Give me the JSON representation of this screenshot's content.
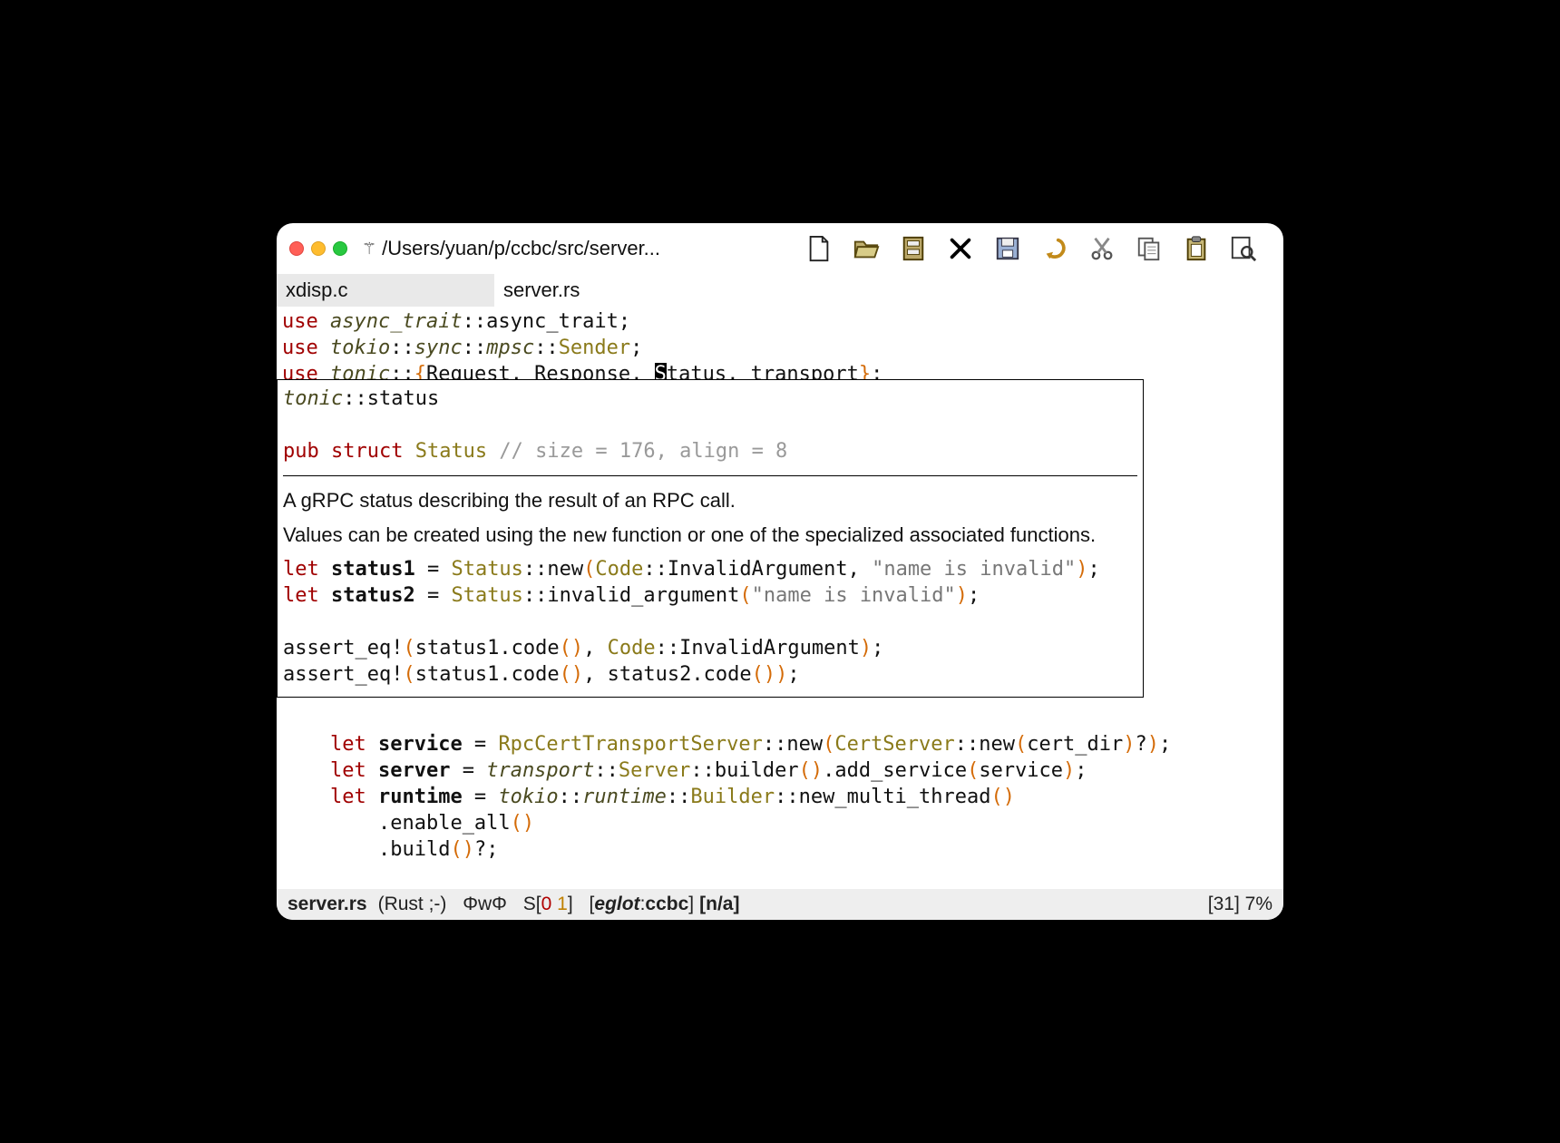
{
  "window": {
    "vc_glyph": "⚚",
    "title": "/Users/yuan/p/ccbc/src/server..."
  },
  "toolbar": {
    "new": "New",
    "open": "Open",
    "dir": "Dired",
    "kill": "Kill buffer",
    "save": "Save",
    "undo": "Undo",
    "cut": "Cut",
    "copy": "Copy",
    "paste": "Paste",
    "search": "Search"
  },
  "tabs": [
    {
      "label": "xdisp.c",
      "active": false
    },
    {
      "label": "server.rs",
      "active": true
    }
  ],
  "code_top": {
    "l1": {
      "kw": "use ",
      "mod": "async_trait",
      "rest": "::async_trait;"
    },
    "l2": {
      "kw": "use ",
      "mod1": "tokio",
      "sep1": "::",
      "mod2": "sync",
      "sep2": "::",
      "mod3": "mpsc",
      "sep3": "::",
      "typ": "Sender",
      "end": ";"
    },
    "l3": {
      "kw": "use ",
      "mod": "tonic",
      "sep": "::",
      "lb": "{",
      "items": "Request, Response, ",
      "curS": "S",
      "curRest": "tatus",
      "comma": ", transport",
      "rb": "}",
      "end": ";"
    }
  },
  "popup": {
    "breadcrumb_mod": "tonic",
    "breadcrumb_rest": "::status",
    "sig_pub": "pub ",
    "sig_struct": "struct ",
    "sig_name": "Status ",
    "sig_comment": "// size = 176, align = 8",
    "para1": "A gRPC status describing the result of an RPC call.",
    "para2a": "Values can be created using the ",
    "para2_code": "new",
    "para2b": " function or one of the specialized associated functions.",
    "ex1": {
      "let": "let ",
      "v": "status1",
      "eq": " = ",
      "t": "Status",
      "call": "::new",
      "lp": "(",
      "code": "Code",
      "ia": "::InvalidArgument",
      "cm": ", ",
      "str": "\"name is invalid\"",
      "rp": ")",
      "end": ";"
    },
    "ex2": {
      "let": "let ",
      "v": "status2",
      "eq": " = ",
      "t": "Status",
      "call": "::invalid_argument",
      "lp": "(",
      "str": "\"name is invalid\"",
      "rp": ")",
      "end": ";"
    },
    "a1": {
      "mac": "assert_eq!",
      "lp": "(",
      "body1": "status1.code",
      "lp2": "()",
      "cm": ", ",
      "code": "Code",
      "ia": "::InvalidArgument",
      "rp": ")",
      "end": ";"
    },
    "a2": {
      "mac": "assert_eq!",
      "lp": "(",
      "body1": "status1.code",
      "lp2": "()",
      "cm": ", ",
      "body2": "status2.code",
      "lp3": "()",
      "rp": ")",
      "end": ";"
    }
  },
  "code_below": {
    "l1": {
      "ind": "    ",
      "let": "let ",
      "v": "service",
      "eq": " = ",
      "t": "RpcCertTransportServer",
      "call": "::new",
      "lp": "(",
      "t2": "CertServer",
      "call2": "::new",
      "lp2": "(",
      "arg": "cert_dir",
      "rp2": ")",
      "q": "?",
      "rp": ")",
      "end": ";"
    },
    "l2": {
      "ind": "    ",
      "let": "let ",
      "v": "server",
      "eq": " = ",
      "mod": "transport",
      "sep": "::",
      "t": "Server",
      "call": "::builder",
      "lp": "()",
      "dot": ".",
      "m": "add_service",
      "lp2": "(",
      "arg": "service",
      "rp2": ")",
      "end": ";"
    },
    "l3": {
      "ind": "    ",
      "let": "let ",
      "v": "runtime",
      "eq": " = ",
      "mod": "tokio",
      "sep": "::",
      "mod2": "runtime",
      "sep2": "::",
      "t": "Builder",
      "call": "::new_multi_thread",
      "lp": "()"
    },
    "l4": {
      "ind": "        ",
      "dot": ".",
      "m": "enable_all",
      "lp": "()"
    },
    "l5": {
      "ind": "        ",
      "dot": ".",
      "m": "build",
      "lp": "()",
      "q": "?",
      "end": ";"
    }
  },
  "modeline": {
    "filename": "server.rs",
    "mode": "(Rust ;-)",
    "encoding": "ΦwΦ",
    "s_pre": "S[",
    "s_err": "0",
    "s_sp": " ",
    "s_warn": "1",
    "s_post": "]",
    "eglot_open": "[",
    "eglot_name": "eglot",
    "eglot_sep": ":",
    "eglot_proj": "ccbc",
    "eglot_close": "]",
    "na": "[n/a]",
    "col": "[31]",
    "percent": "7%"
  }
}
